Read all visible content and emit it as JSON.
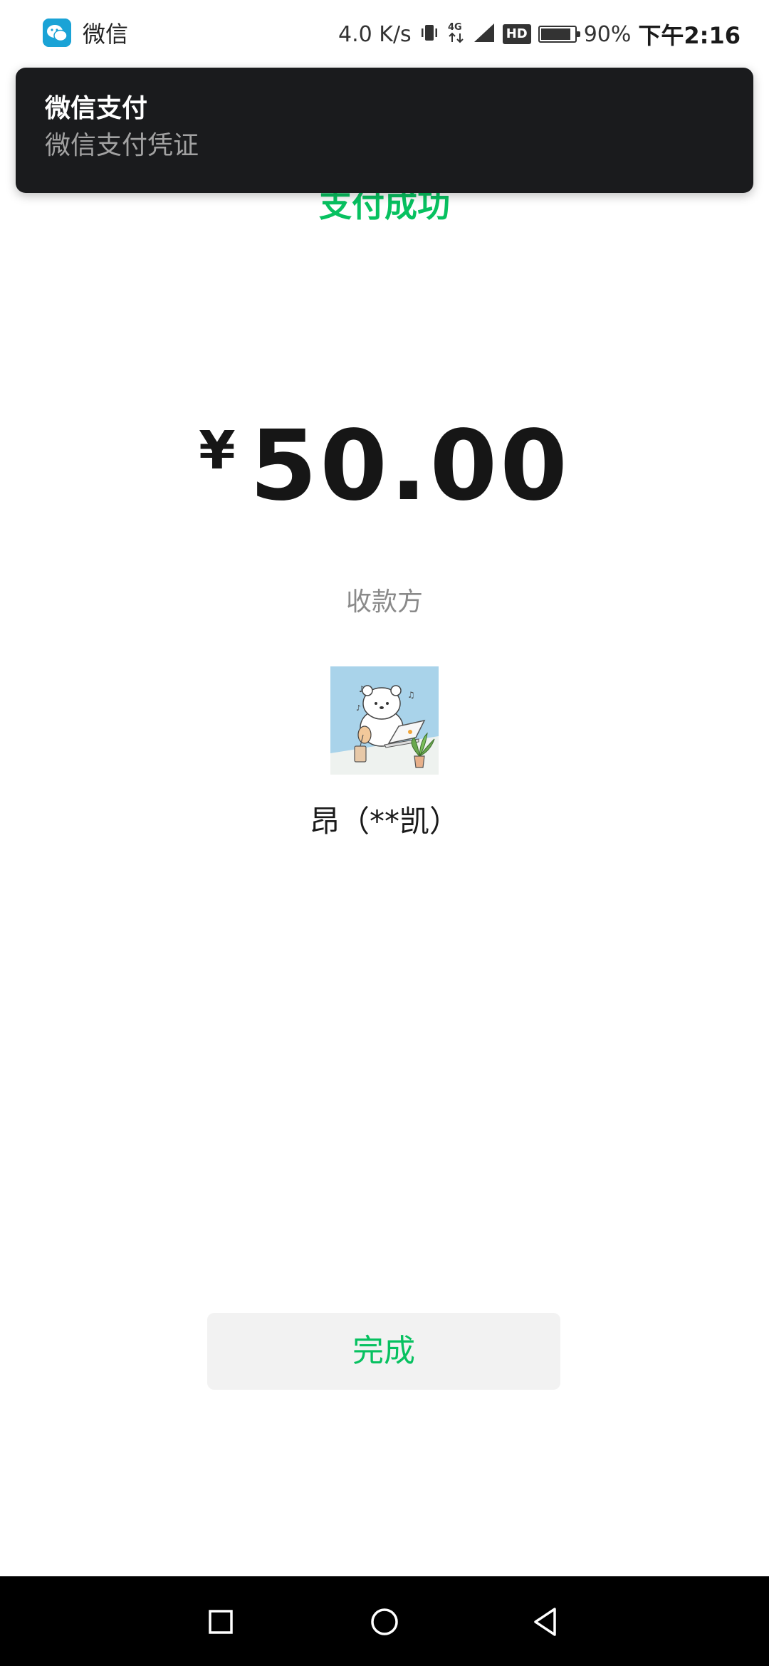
{
  "status_bar": {
    "app_icon": "wechat-app-icon",
    "app_name": "微信",
    "network_speed": "4.0 K/s",
    "vibrate_icon": "vibrate-icon",
    "network_type": "4G",
    "signal_icon": "signal-icon",
    "hd_badge": "HD",
    "battery_icon": "battery-icon",
    "battery_level": 0.9,
    "battery_percent": "90%",
    "time": "下午2:16"
  },
  "notification": {
    "title": "微信支付",
    "body": "微信支付凭证"
  },
  "payment": {
    "status_title": "支付成功",
    "currency_symbol": "¥",
    "amount": "50.00",
    "payee_label": "收款方",
    "payee_avatar": "payee-avatar-bear-illustration",
    "payee_name": "昂（**凯）",
    "done_label": "完成"
  },
  "nav_bar": {
    "recents_icon": "square-icon",
    "home_icon": "circle-icon",
    "back_icon": "triangle-back-icon"
  },
  "colors": {
    "accent_green": "#07c160",
    "notification_bg": "#1a1b1d",
    "button_bg": "#f2f2f2",
    "nav_bar_bg": "#000000"
  }
}
